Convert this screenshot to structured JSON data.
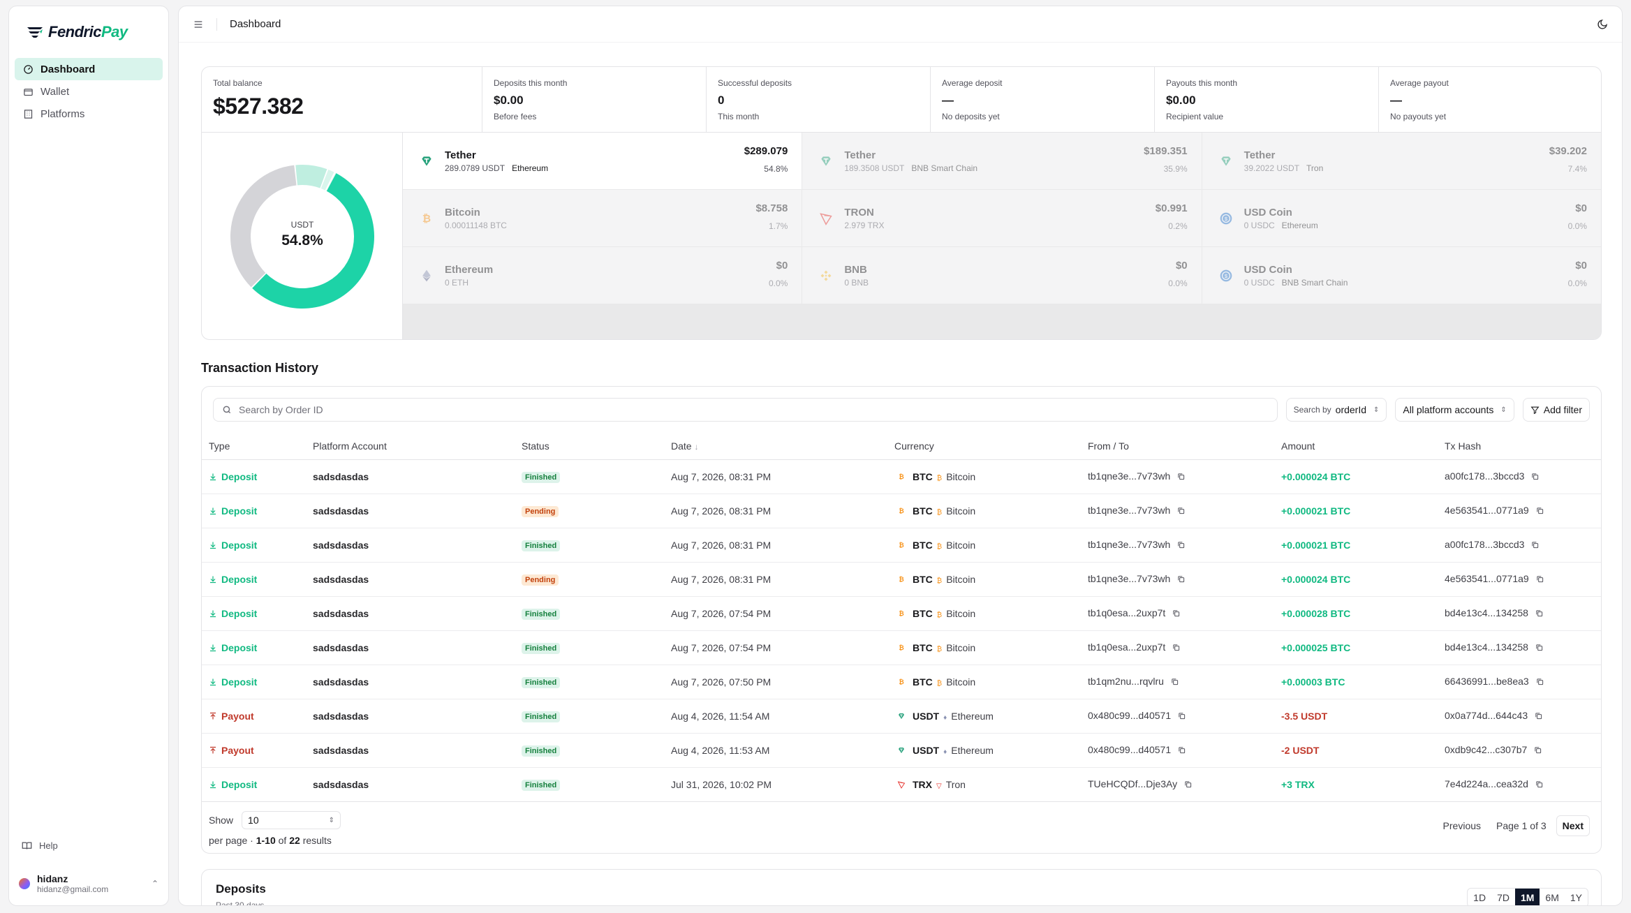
{
  "brand": {
    "part1": "Fendric",
    "part2": "Pay"
  },
  "sidebar": {
    "items": [
      {
        "label": "Dashboard",
        "icon": "gauge-icon",
        "active": true
      },
      {
        "label": "Wallet",
        "icon": "wallet-icon",
        "active": false
      },
      {
        "label": "Platforms",
        "icon": "building-icon",
        "active": false
      }
    ],
    "help": "Help",
    "user": {
      "name": "hidanz",
      "email": "hidanz@gmail.com"
    }
  },
  "header": {
    "breadcrumb": "Dashboard"
  },
  "stats": {
    "total_balance": {
      "label": "Total balance",
      "value": "$527.382"
    },
    "deposits_month": {
      "label": "Deposits this month",
      "value": "$0.00",
      "sub": "Before fees"
    },
    "successful": {
      "label": "Successful deposits",
      "value": "0",
      "sub": "This month"
    },
    "avg_deposit": {
      "label": "Average deposit",
      "value": "—",
      "sub": "No deposits yet"
    },
    "payouts_month": {
      "label": "Payouts this month",
      "value": "$0.00",
      "sub": "Recipient value"
    },
    "avg_payout": {
      "label": "Average payout",
      "value": "—",
      "sub": "No payouts yet"
    }
  },
  "donut": {
    "currency": "USDT",
    "percent": "54.8%",
    "segments": [
      54.8,
      35.9,
      7.4,
      1.7,
      0.2
    ]
  },
  "assets": [
    {
      "name": "Tether",
      "amount": "289.0789 USDT",
      "network": "Ethereum",
      "usd": "$289.079",
      "pct": "54.8%",
      "icon": "tether-icon",
      "active": true
    },
    {
      "name": "Tether",
      "amount": "189.3508 USDT",
      "network": "BNB Smart Chain",
      "usd": "$189.351",
      "pct": "35.9%",
      "icon": "tether-icon",
      "active": false
    },
    {
      "name": "Tether",
      "amount": "39.2022 USDT",
      "network": "Tron",
      "usd": "$39.202",
      "pct": "7.4%",
      "icon": "tether-icon",
      "active": false
    },
    {
      "name": "Bitcoin",
      "amount": "0.00011148 BTC",
      "network": "",
      "usd": "$8.758",
      "pct": "1.7%",
      "icon": "bitcoin-icon",
      "active": false
    },
    {
      "name": "TRON",
      "amount": "2.979 TRX",
      "network": "",
      "usd": "$0.991",
      "pct": "0.2%",
      "icon": "tron-icon",
      "active": false
    },
    {
      "name": "USD Coin",
      "amount": "0 USDC",
      "network": "Ethereum",
      "usd": "$0",
      "pct": "0.0%",
      "icon": "usdc-icon",
      "active": false
    },
    {
      "name": "Ethereum",
      "amount": "0 ETH",
      "network": "",
      "usd": "$0",
      "pct": "0.0%",
      "icon": "ethereum-icon",
      "active": false
    },
    {
      "name": "BNB",
      "amount": "0 BNB",
      "network": "",
      "usd": "$0",
      "pct": "0.0%",
      "icon": "bnb-icon",
      "active": false
    },
    {
      "name": "USD Coin",
      "amount": "0 USDC",
      "network": "BNB Smart Chain",
      "usd": "$0",
      "pct": "0.0%",
      "icon": "usdc-icon",
      "active": false
    }
  ],
  "tx": {
    "title": "Transaction History",
    "search_placeholder": "Search by Order ID",
    "search_by_label": "Search by",
    "search_by_value": "orderId",
    "account_filter": "All platform accounts",
    "add_filter": "Add filter",
    "columns": [
      "Type",
      "Platform Account",
      "Status",
      "Date",
      "Currency",
      "From / To",
      "Amount",
      "Tx Hash"
    ],
    "rows": [
      {
        "type": "Deposit",
        "account": "sadsdasdas",
        "status": "Finished",
        "date": "Aug 7, 2026, 08:31 PM",
        "sym": "BTC",
        "net": "Bitcoin",
        "addr": "tb1qne3e...7v73wh",
        "amount": "+0.000024 BTC",
        "hash": "a00fc178...3bccd3"
      },
      {
        "type": "Deposit",
        "account": "sadsdasdas",
        "status": "Pending",
        "date": "Aug 7, 2026, 08:31 PM",
        "sym": "BTC",
        "net": "Bitcoin",
        "addr": "tb1qne3e...7v73wh",
        "amount": "+0.000021 BTC",
        "hash": "4e563541...0771a9"
      },
      {
        "type": "Deposit",
        "account": "sadsdasdas",
        "status": "Finished",
        "date": "Aug 7, 2026, 08:31 PM",
        "sym": "BTC",
        "net": "Bitcoin",
        "addr": "tb1qne3e...7v73wh",
        "amount": "+0.000021 BTC",
        "hash": "a00fc178...3bccd3"
      },
      {
        "type": "Deposit",
        "account": "sadsdasdas",
        "status": "Pending",
        "date": "Aug 7, 2026, 08:31 PM",
        "sym": "BTC",
        "net": "Bitcoin",
        "addr": "tb1qne3e...7v73wh",
        "amount": "+0.000024 BTC",
        "hash": "4e563541...0771a9"
      },
      {
        "type": "Deposit",
        "account": "sadsdasdas",
        "status": "Finished",
        "date": "Aug 7, 2026, 07:54 PM",
        "sym": "BTC",
        "net": "Bitcoin",
        "addr": "tb1q0esa...2uxp7t",
        "amount": "+0.000028 BTC",
        "hash": "bd4e13c4...134258"
      },
      {
        "type": "Deposit",
        "account": "sadsdasdas",
        "status": "Finished",
        "date": "Aug 7, 2026, 07:54 PM",
        "sym": "BTC",
        "net": "Bitcoin",
        "addr": "tb1q0esa...2uxp7t",
        "amount": "+0.000025 BTC",
        "hash": "bd4e13c4...134258"
      },
      {
        "type": "Deposit",
        "account": "sadsdasdas",
        "status": "Finished",
        "date": "Aug 7, 2026, 07:50 PM",
        "sym": "BTC",
        "net": "Bitcoin",
        "addr": "tb1qm2nu...rqvlru",
        "amount": "+0.00003 BTC",
        "hash": "66436991...be8ea3"
      },
      {
        "type": "Payout",
        "account": "sadsdasdas",
        "status": "Finished",
        "date": "Aug 4, 2026, 11:54 AM",
        "sym": "USDT",
        "net": "Ethereum",
        "addr": "0x480c99...d40571",
        "amount": "-3.5 USDT",
        "hash": "0x0a774d...644c43"
      },
      {
        "type": "Payout",
        "account": "sadsdasdas",
        "status": "Finished",
        "date": "Aug 4, 2026, 11:53 AM",
        "sym": "USDT",
        "net": "Ethereum",
        "addr": "0x480c99...d40571",
        "amount": "-2 USDT",
        "hash": "0xdb9c42...c307b7"
      },
      {
        "type": "Deposit",
        "account": "sadsdasdas",
        "status": "Finished",
        "date": "Jul 31, 2026, 10:02 PM",
        "sym": "TRX",
        "net": "Tron",
        "addr": "TUeHCQDf...Dje3Ay",
        "amount": "+3 TRX",
        "hash": "7e4d224a...cea32d"
      }
    ],
    "pager": {
      "show_label": "Show",
      "page_size": "10",
      "per_page": "per page ·",
      "range": "1-10",
      "of": "of",
      "total": "22",
      "results": "results",
      "previous": "Previous",
      "page_info": "Page 1 of 3",
      "next": "Next"
    }
  },
  "deposits": {
    "title": "Deposits",
    "subtitle": "Past 30 days",
    "ranges": [
      "1D",
      "7D",
      "1M",
      "6M",
      "1Y"
    ],
    "active_range": "1M"
  },
  "colors": {
    "accent": "#10b981",
    "donut_main": "#1dd3a7",
    "donut_gray": "#d4d4d8",
    "danger": "#c0392b"
  }
}
